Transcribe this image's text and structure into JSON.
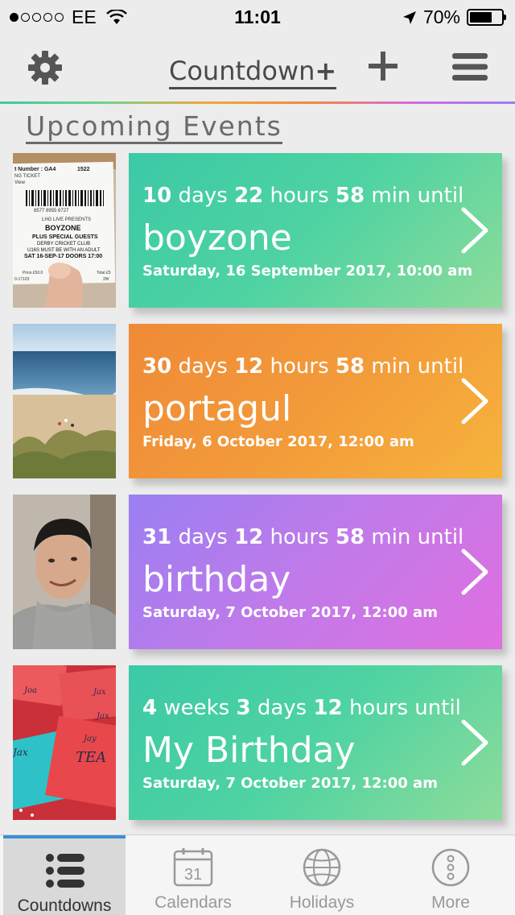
{
  "status_bar": {
    "carrier": "EE",
    "time": "11:01",
    "battery": "70%"
  },
  "header": {
    "title": "Countdown",
    "title_plus": "+"
  },
  "section_title": "Upcoming Events",
  "events": [
    {
      "amount1": "10",
      "unit1": "days",
      "amount2": "22",
      "unit2": "hours",
      "amount3": "58",
      "unit3": "min until",
      "name": "boyzone",
      "date": "Saturday, 16 September 2017, 10:00 am",
      "color": "#3cc9a6"
    },
    {
      "amount1": "30",
      "unit1": "days",
      "amount2": "12",
      "unit2": "hours",
      "amount3": "58",
      "unit3": "min until",
      "name": "portagul",
      "date": "Friday, 6 October 2017, 12:00 am",
      "color": "#f08a38"
    },
    {
      "amount1": "31",
      "unit1": "days",
      "amount2": "12",
      "unit2": "hours",
      "amount3": "58",
      "unit3": "min until",
      "name": "birthday",
      "date": "Saturday, 7 October 2017, 12:00 am",
      "color": "#c17ae9"
    },
    {
      "amount1": "4",
      "unit1": "weeks",
      "amount2": "3",
      "unit2": "days",
      "amount3": "12",
      "unit3": "hours until",
      "name": "My Birthday",
      "date": "Saturday, 7 October 2017, 12:00 am",
      "color": "#3cc9a6"
    }
  ],
  "ticket_text": {
    "number_label": "t Number : GA4",
    "number": "1522",
    "ticket": "NG TICKET",
    "view": "View",
    "barcode_number": "8577 8955 6727",
    "presenter": "LHG LIVE PRESENTS",
    "band": "BOYZONE",
    "guests": "PLUS SPECIAL GUESTS",
    "venue": "DERBY CRICKET CLUB",
    "age": "U16S MUST BE WITH AN ADULT",
    "datetime": "SAT 16-SEP-17 DOORS 17:00",
    "price": "Price £50.0",
    "total": "Total £5",
    "ref": "0-17103",
    "extra": "2W"
  },
  "envelope_text": {
    "a": "Jax",
    "b": "Joa",
    "c": "Jax",
    "d": "Jay",
    "e": "TEA",
    "f": "Jax"
  },
  "calendar_day": "31",
  "tabs": [
    {
      "label": "Countdowns",
      "active": true
    },
    {
      "label": "Calendars",
      "active": false
    },
    {
      "label": "Holidays",
      "active": false
    },
    {
      "label": "More",
      "active": false
    }
  ],
  "colors": {
    "accent_blue": "#3a8fd8",
    "teal": "#3cc9a6",
    "orange": "#f08a38",
    "purple": "#c17ae9"
  }
}
